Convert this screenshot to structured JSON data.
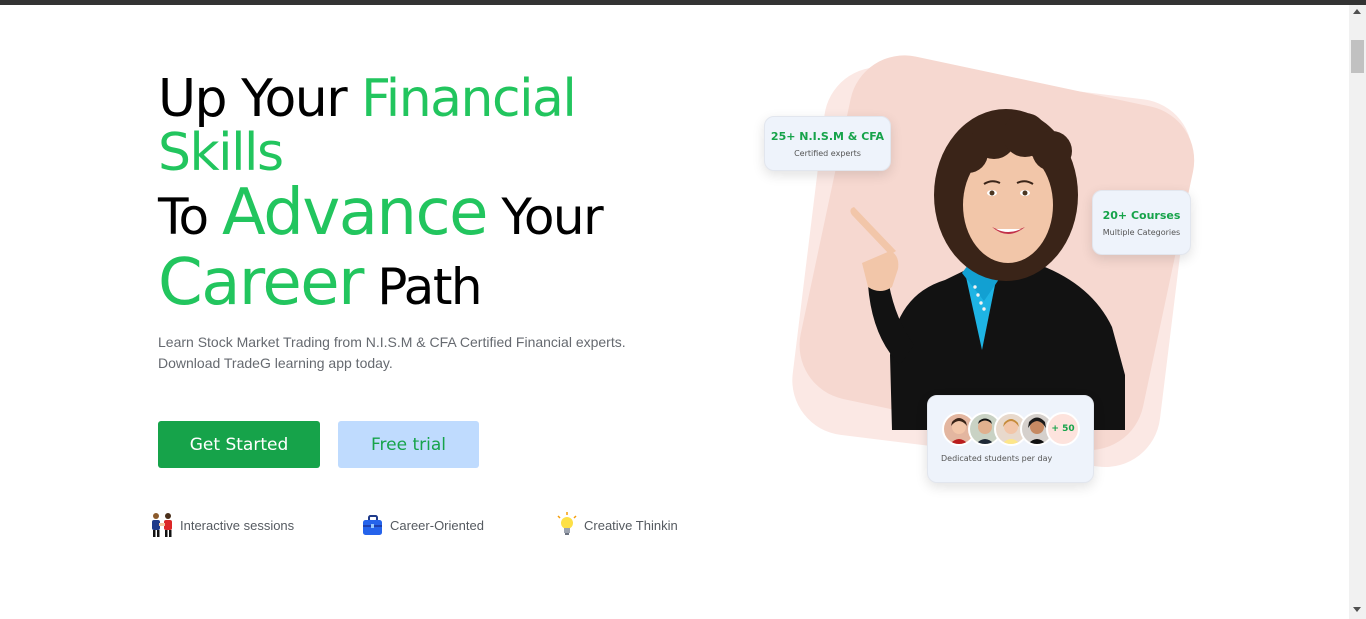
{
  "hero": {
    "line1": {
      "part1": "Up Your ",
      "part2": "Financial"
    },
    "line2": {
      "part1": "Skills"
    },
    "line3": {
      "part1": "To ",
      "part2": "Advance",
      "part3": " Your"
    },
    "line4": {
      "part1": "Career",
      "part2": " Path"
    },
    "description_line1": "Learn Stock Market Trading from N.I.S.M & CFA Certified Financial experts.",
    "description_line2": "Download TradeG learning app today."
  },
  "buttons": {
    "get_started": "Get Started",
    "free_trial": "Free trial"
  },
  "features": [
    {
      "label": "Interactive sessions",
      "icon": "people-meeting-icon"
    },
    {
      "label": "Career-Oriented",
      "icon": "briefcase-icon"
    },
    {
      "label": "Creative Thinkin",
      "icon": "lightbulb-icon"
    }
  ],
  "cards": {
    "experts": {
      "title": "25+ N.I.S.M & CFA",
      "subtitle": "Certified experts"
    },
    "courses": {
      "title": "20+ Courses",
      "subtitle": "Multiple Categories"
    },
    "students": {
      "count_badge": "+ 50",
      "subtitle": "Dedicated students per day"
    }
  },
  "colors": {
    "accent_green": "#22c55e",
    "button_green": "#16a34a",
    "trial_bg": "#bfdbfe",
    "blob_pink": "#f8ddd6"
  }
}
